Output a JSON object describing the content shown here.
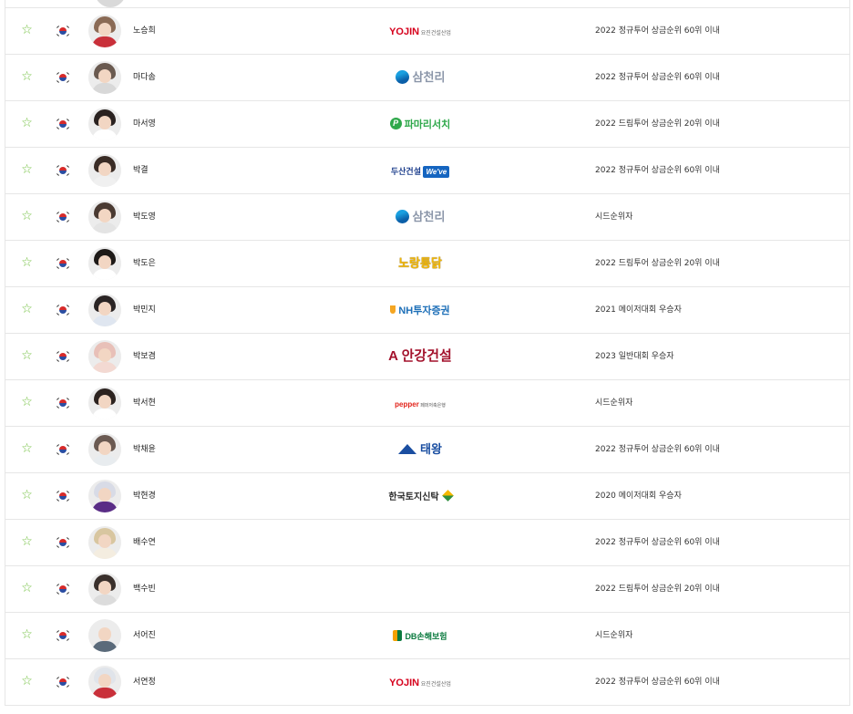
{
  "colors": {
    "star": "#6fbf3b",
    "border": "#e6e6e6"
  },
  "icons": {
    "favorite": "star-outline-icon",
    "nationality": "korea-flag-icon"
  },
  "players": [
    {
      "star": "☆",
      "name": "노승희",
      "sponsor": {
        "text": "YOJIN",
        "sub": "요진건설산업",
        "color": "#d6001c"
      },
      "qualification": "2022 정규투어 상금순위 60위 이내",
      "hair": "#8a6a55",
      "shirt": "#c9303a"
    },
    {
      "star": "☆",
      "name": "마다솜",
      "sponsor": {
        "text": "삼천리",
        "color": "#7a8aa6"
      },
      "qualification": "2022 정규투어 상금순위 60위 이내",
      "hair": "#6a5a50",
      "shirt": "#d8d8d8"
    },
    {
      "star": "☆",
      "name": "마서영",
      "sponsor": {
        "text": "파마리서치",
        "color": "#2ea84a"
      },
      "qualification": "2022 드림투어 상금순위 20위 이내",
      "hair": "#2a2220",
      "shirt": "#ffffff"
    },
    {
      "star": "☆",
      "name": "박결",
      "sponsor": {
        "text": "두산건설",
        "badge": "We've",
        "color": "#1565c0"
      },
      "qualification": "2022 정규투어 상금순위 60위 이내",
      "hair": "#3a2c26",
      "shirt": "#f0f0f0"
    },
    {
      "star": "☆",
      "name": "박도영",
      "sponsor": {
        "text": "삼천리",
        "color": "#7a8aa6"
      },
      "qualification": "시드순위자",
      "hair": "#4a3a32",
      "shirt": "#e4e4e4"
    },
    {
      "star": "☆",
      "name": "박도은",
      "sponsor": {
        "text": "노랑통닭",
        "color": "#f2b705"
      },
      "qualification": "2022 드림투어 상금순위 20위 이내",
      "hair": "#1e1a18",
      "shirt": "#ffffff"
    },
    {
      "star": "☆",
      "name": "박민지",
      "sponsor": {
        "text": "NH투자증권",
        "color": "#1d6fb8"
      },
      "qualification": "2021 메이저대회 우승자",
      "hair": "#2a2424",
      "shirt": "#dfe6f0"
    },
    {
      "star": "☆",
      "name": "박보겸",
      "sponsor": {
        "text": "안강건설",
        "color": "#a3122c"
      },
      "qualification": "2023 일반대회 우승자",
      "hair": "#e8c0b8",
      "shirt": "#f3d9d2"
    },
    {
      "star": "☆",
      "name": "박서현",
      "sponsor": {
        "text": "pepper",
        "sub": "페퍼저축은행",
        "color": "#e2231a"
      },
      "qualification": "시드순위자",
      "hair": "#2c2320",
      "shirt": "#ffffff"
    },
    {
      "star": "☆",
      "name": "박채윤",
      "sponsor": {
        "text": "태왕",
        "color": "#1a4ea1"
      },
      "qualification": "2022 정규투어 상금순위 60위 이내",
      "hair": "#6b5a52",
      "shirt": "#e8ecef"
    },
    {
      "star": "☆",
      "name": "박현경",
      "sponsor": {
        "text": "한국토지신탁",
        "color": "#2b2b2b"
      },
      "qualification": "2020 메이저대회 우승자",
      "hair": "#d8dbe6",
      "shirt": "#5a2d86"
    },
    {
      "star": "☆",
      "name": "배수연",
      "sponsor": {
        "text": ""
      },
      "qualification": "2022 정규투어 상금순위 60위 이내",
      "hair": "#d8c6a0",
      "shirt": "#f4ede0"
    },
    {
      "star": "☆",
      "name": "백수빈",
      "sponsor": {
        "text": ""
      },
      "qualification": "2022 드림투어 상금순위 20위 이내",
      "hair": "#3a302c",
      "shirt": "#dcdcdc"
    },
    {
      "star": "☆",
      "name": "서어진",
      "sponsor": {
        "text": "DB손해보험",
        "color": "#0a7a3e"
      },
      "qualification": "시드순위자",
      "hair": "#ececec",
      "shirt": "#5a6a7a"
    },
    {
      "star": "☆",
      "name": "서연정",
      "sponsor": {
        "text": "YOJIN",
        "sub": "요진건설산업",
        "color": "#d6001c"
      },
      "qualification": "2022 정규투어 상금순위 60위 이내",
      "hair": "#e0e4ea",
      "shirt": "#c9303a"
    }
  ]
}
